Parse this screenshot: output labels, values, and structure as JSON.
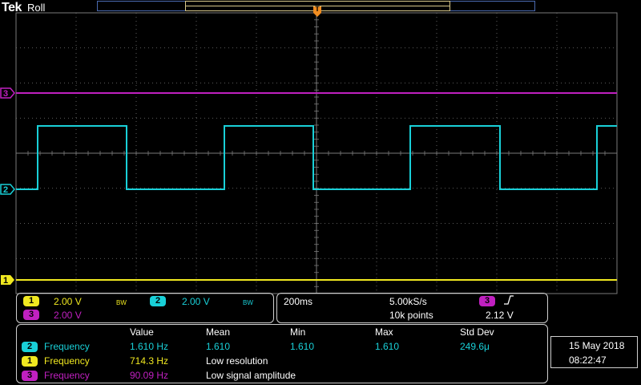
{
  "header": {
    "brand": "Tek",
    "mode": "Roll",
    "trigger_marker": "T"
  },
  "channels": [
    {
      "number": "1",
      "scale": "2.00 V",
      "bw_flag": "BW",
      "color": "#f0e820",
      "marker": "1"
    },
    {
      "number": "2",
      "scale": "2.00 V",
      "bw_flag": "BW",
      "color": "#19d0d8",
      "marker": "2"
    },
    {
      "number": "3",
      "scale": "2.00 V",
      "color": "#c020c0",
      "marker": "3"
    }
  ],
  "timebase": {
    "time_per_div": "200ms",
    "sample_rate": "5.00kS/s",
    "record_length": "10k points",
    "trigger_source": "3",
    "trigger_slope_icon": "rising-edge-icon",
    "trigger_level": "2.12 V"
  },
  "measurements": {
    "headers": [
      "Value",
      "Mean",
      "Min",
      "Max",
      "Std Dev"
    ],
    "rows": [
      {
        "channel": "2",
        "name": "Frequency",
        "value": "1.610 Hz",
        "mean": "1.610",
        "min": "1.610",
        "max": "1.610",
        "std_dev": "249.6μ",
        "note": ""
      },
      {
        "channel": "1",
        "name": "Frequency",
        "value": "714.3 Hz",
        "mean": "",
        "min": "",
        "max": "",
        "std_dev": "",
        "note": "Low resolution"
      },
      {
        "channel": "3",
        "name": "Frequency",
        "value": "90.09 Hz",
        "mean": "",
        "min": "",
        "max": "",
        "std_dev": "",
        "note": "Low signal amplitude"
      }
    ]
  },
  "datetime": {
    "date": "15 May 2018",
    "time": "08:22:47"
  },
  "colors": {
    "ch1": "#f0e820",
    "ch2": "#19d0d8",
    "ch3": "#c020c0",
    "trigger": "#f08c20",
    "graticule": "#7a7a7a"
  }
}
